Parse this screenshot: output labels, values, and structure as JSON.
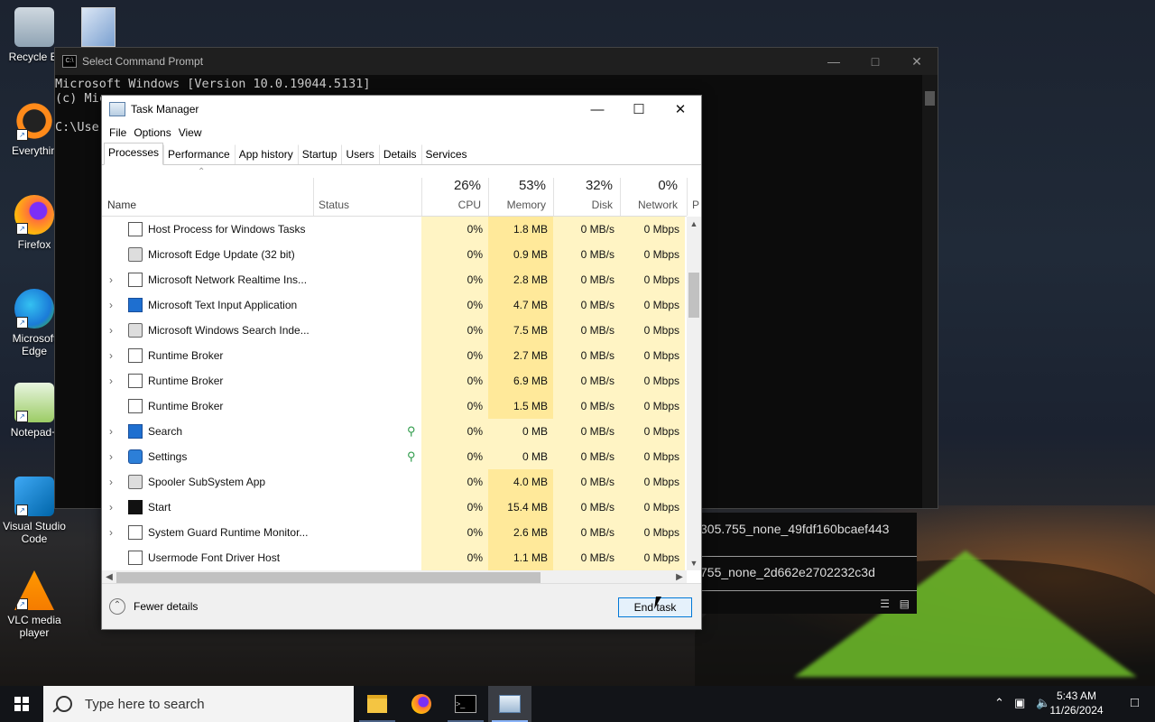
{
  "desktop": {
    "icons": [
      {
        "label": "Recycle Bi",
        "icon": "recycle-bin-icon"
      },
      {
        "label": "Everythin",
        "icon": "everything-search-icon"
      },
      {
        "label": "Firefox",
        "icon": "firefox-icon"
      },
      {
        "label": "Microsoft Edge",
        "icon": "edge-icon"
      },
      {
        "label": "Notepad+",
        "icon": "notepad-plus-plus-icon"
      },
      {
        "label": "Visual Studio Code",
        "icon": "vscode-icon"
      },
      {
        "label": "VLC media player",
        "icon": "vlc-icon"
      }
    ]
  },
  "cmd": {
    "title": "Select Command Prompt",
    "line1": "Microsoft Windows [Version 10.0.19044.5131]",
    "line2": "(c) Mic",
    "line3": "C:\\User",
    "lower_line1": "305.755_none_49fdf160bcaef443",
    "lower_line2": "755_none_2d662e2702232c3d"
  },
  "taskmanager": {
    "title": "Task Manager",
    "menu": [
      "File",
      "Options",
      "View"
    ],
    "tabs": [
      "Processes",
      "Performance",
      "App history",
      "Startup",
      "Users",
      "Details",
      "Services"
    ],
    "active_tab": "Processes",
    "columns": {
      "name": "Name",
      "status": "Status",
      "cpu": {
        "pct": "26%",
        "label": "CPU"
      },
      "memory": {
        "pct": "53%",
        "label": "Memory"
      },
      "disk": {
        "pct": "32%",
        "label": "Disk"
      },
      "network": {
        "pct": "0%",
        "label": "Network"
      },
      "next": "P"
    },
    "processes": [
      {
        "name": "Host Process for Windows Tasks",
        "expandable": false,
        "icon": "window-icon",
        "leaf": false,
        "cpu": "0%",
        "mem": "1.8 MB",
        "disk": "0 MB/s",
        "net": "0 Mbps"
      },
      {
        "name": "Microsoft Edge Update (32 bit)",
        "expandable": false,
        "icon": "edge-update-icon",
        "leaf": false,
        "cpu": "0%",
        "mem": "0.9 MB",
        "disk": "0 MB/s",
        "net": "0 Mbps"
      },
      {
        "name": "Microsoft Network Realtime Ins...",
        "expandable": true,
        "icon": "window-icon",
        "leaf": false,
        "cpu": "0%",
        "mem": "2.8 MB",
        "disk": "0 MB/s",
        "net": "0 Mbps"
      },
      {
        "name": "Microsoft Text Input Application",
        "expandable": true,
        "icon": "blue-window-icon",
        "leaf": false,
        "cpu": "0%",
        "mem": "4.7 MB",
        "disk": "0 MB/s",
        "net": "0 Mbps"
      },
      {
        "name": "Microsoft Windows Search Inde...",
        "expandable": true,
        "icon": "search-indexer-icon",
        "leaf": false,
        "cpu": "0%",
        "mem": "7.5 MB",
        "disk": "0 MB/s",
        "net": "0 Mbps"
      },
      {
        "name": "Runtime Broker",
        "expandable": true,
        "icon": "window-icon",
        "leaf": false,
        "cpu": "0%",
        "mem": "2.7 MB",
        "disk": "0 MB/s",
        "net": "0 Mbps"
      },
      {
        "name": "Runtime Broker",
        "expandable": true,
        "icon": "window-icon",
        "leaf": false,
        "cpu": "0%",
        "mem": "6.9 MB",
        "disk": "0 MB/s",
        "net": "0 Mbps"
      },
      {
        "name": "Runtime Broker",
        "expandable": false,
        "icon": "window-icon",
        "leaf": false,
        "cpu": "0%",
        "mem": "1.5 MB",
        "disk": "0 MB/s",
        "net": "0 Mbps"
      },
      {
        "name": "Search",
        "expandable": true,
        "icon": "search-app-icon",
        "leaf": true,
        "cpu": "0%",
        "mem": "0 MB",
        "disk": "0 MB/s",
        "net": "0 Mbps"
      },
      {
        "name": "Settings",
        "expandable": true,
        "icon": "settings-gear-icon",
        "leaf": true,
        "cpu": "0%",
        "mem": "0 MB",
        "disk": "0 MB/s",
        "net": "0 Mbps"
      },
      {
        "name": "Spooler SubSystem App",
        "expandable": true,
        "icon": "printer-icon",
        "leaf": false,
        "cpu": "0%",
        "mem": "4.0 MB",
        "disk": "0 MB/s",
        "net": "0 Mbps"
      },
      {
        "name": "Start",
        "expandable": true,
        "icon": "start-icon",
        "leaf": false,
        "cpu": "0%",
        "mem": "15.4 MB",
        "disk": "0 MB/s",
        "net": "0 Mbps"
      },
      {
        "name": "System Guard Runtime Monitor...",
        "expandable": true,
        "icon": "window-icon",
        "leaf": false,
        "cpu": "0%",
        "mem": "2.6 MB",
        "disk": "0 MB/s",
        "net": "0 Mbps"
      },
      {
        "name": "Usermode Font Driver Host",
        "expandable": false,
        "icon": "window-icon",
        "leaf": false,
        "cpu": "0%",
        "mem": "1.1 MB",
        "disk": "0 MB/s",
        "net": "0 Mbps"
      }
    ],
    "fewer_details": "Fewer details",
    "end_task": "End task"
  },
  "taskbar": {
    "search_placeholder": "Type here to search",
    "apps": [
      "file-explorer-icon",
      "firefox-icon",
      "command-prompt-icon",
      "task-manager-icon"
    ],
    "time": "5:43 AM",
    "date": "11/26/2024"
  },
  "colors": {
    "accent": "#0078d7",
    "cpu_fill": "#fff4c4",
    "mem_fill": "#ffe99a"
  }
}
